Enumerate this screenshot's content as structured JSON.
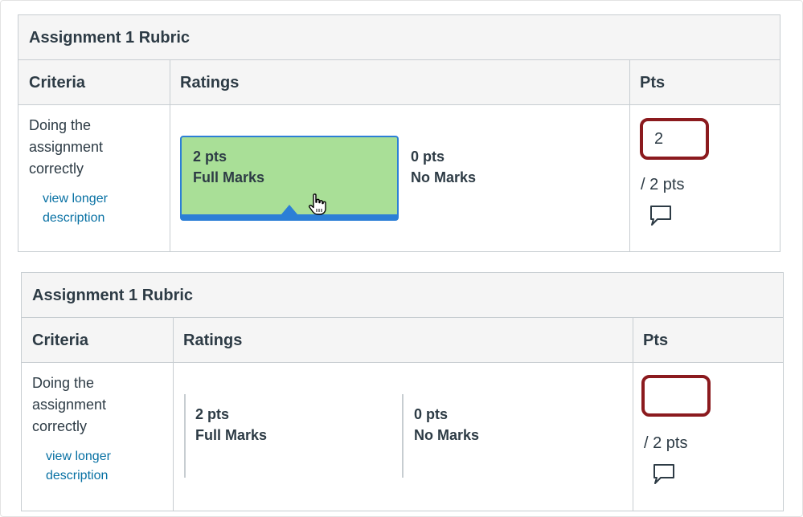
{
  "rubrics": [
    {
      "title": "Assignment 1 Rubric",
      "headers": {
        "criteria": "Criteria",
        "ratings": "Ratings",
        "pts": "Pts"
      },
      "criterion": {
        "description": "Doing the assignment correctly",
        "link": "view longer description"
      },
      "ratings": [
        {
          "pts": "2 pts",
          "name": "Full Marks",
          "selected": true
        },
        {
          "pts": "0 pts",
          "name": "No Marks",
          "selected": false
        }
      ],
      "points_value": "2",
      "points_total": "/ 2 pts"
    },
    {
      "title": "Assignment 1 Rubric",
      "headers": {
        "criteria": "Criteria",
        "ratings": "Ratings",
        "pts": "Pts"
      },
      "criterion": {
        "description": "Doing the assignment correctly",
        "link": "view longer description"
      },
      "ratings": [
        {
          "pts": "2 pts",
          "name": "Full Marks",
          "selected": false
        },
        {
          "pts": "0 pts",
          "name": "No Marks",
          "selected": false
        }
      ],
      "points_value": "",
      "points_total": "/ 2 pts"
    }
  ],
  "icons": {
    "comment": "comment-icon",
    "cursor": "hand-pointer-icon"
  },
  "colors": {
    "selected_fill": "#a9df97",
    "selected_border": "#2c7fd6",
    "highlight_box": "#8b1a1e",
    "link": "#0770a3"
  }
}
